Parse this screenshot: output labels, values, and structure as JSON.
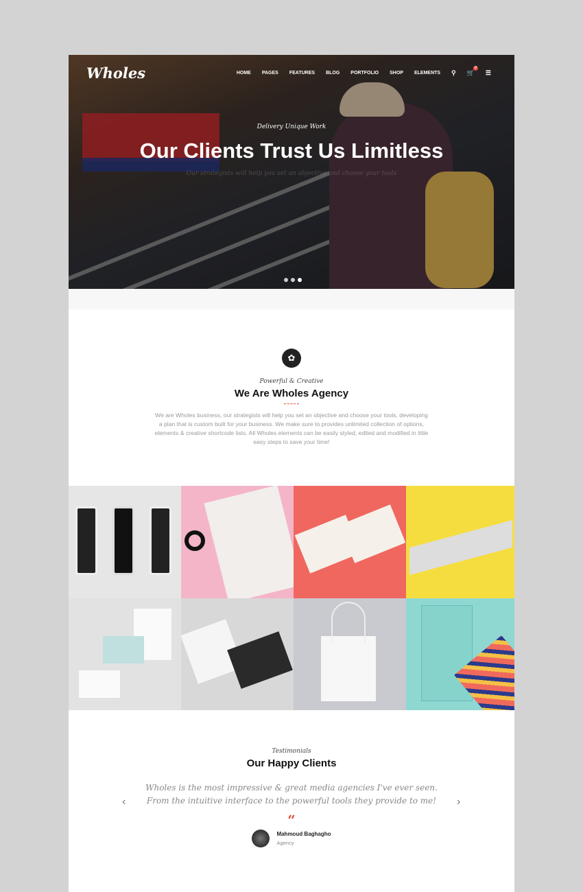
{
  "header": {
    "logo": "Wholes",
    "nav": [
      "HOME",
      "PAGES",
      "FEATURES",
      "BLOG",
      "PORTFOLIO",
      "SHOP",
      "ELEMENTS"
    ],
    "cart_count": "0"
  },
  "hero": {
    "kicker": "Delivery Unique Work",
    "title": "Our Clients Trust Us Limitless",
    "subtitle": "Our strategists will help you set an objective and choose your tools",
    "slides": 3,
    "active_slide": 3
  },
  "about": {
    "kicker": "Powerful & Creative",
    "title": "We Are Wholes Agency",
    "text": "We are Wholes business, our strategists will help you set an objective and choose your tools, developing a plan that is custom built for your business. We make sure to provides unlimited collection of options, elements & creative shortcode lists. All Wholes elements can be easily styled, edited and modified in little easy steps to save your time!"
  },
  "portfolio": [
    {
      "name": "iphone-mockups",
      "bg": "#e6e6e6"
    },
    {
      "name": "pink-bag",
      "bg": "#f4b5c8"
    },
    {
      "name": "business-cards-coral",
      "bg": "#f0675f"
    },
    {
      "name": "yellow-cards",
      "bg": "#f6dd3f"
    },
    {
      "name": "stationery",
      "bg": "#e2e2e2"
    },
    {
      "name": "black-cards",
      "bg": "#d8d8d8"
    },
    {
      "name": "tote-bag",
      "bg": "#c9c9d0"
    },
    {
      "name": "coffee-bag",
      "bg": "#8fd8d2"
    }
  ],
  "testimonials": {
    "kicker": "Testimonials",
    "title": "Our Happy Clients",
    "quote": "Wholes is the most impressive & great media agencies I've ever seen. From the intuitive interface to the powerful tools they provide to me!",
    "quote_mark": "“",
    "author": "Mahmoud Baghagho",
    "role": "Agency"
  },
  "colors": {
    "accent": "#e74c3c",
    "background": "#d3d3d3"
  }
}
